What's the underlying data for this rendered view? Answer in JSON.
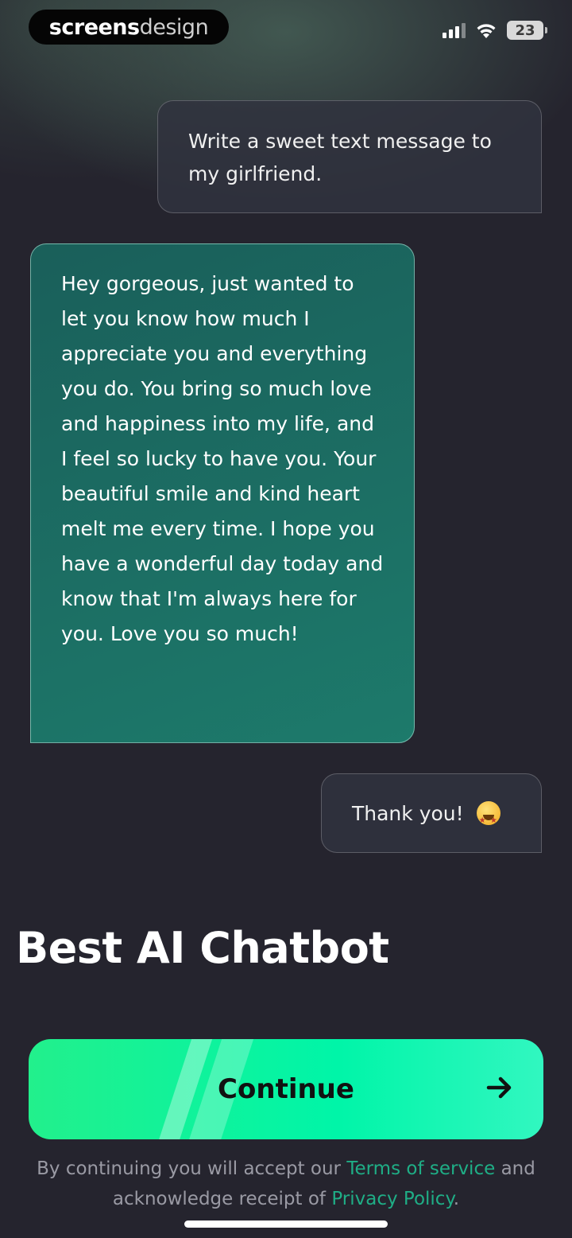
{
  "status_bar": {
    "brand_part1": "screens",
    "brand_part2": "design",
    "battery": "23"
  },
  "chat": {
    "user_message_1": "Write a sweet text message to my girlfriend.",
    "ai_reply": "Hey gorgeous, just wanted to let you know how much I appreciate you and everything you do. You bring so much love and happiness into my life, and I feel so lucky to have you. Your beautiful smile and kind heart melt me every time. I hope you have a wonderful day today and know that I'm always here for you. Love you so much!",
    "user_message_2": "Thank you!",
    "user_message_2_emoji": "star-struck-emoji-icon"
  },
  "headline": "Best AI Chatbot",
  "cta": {
    "label": "Continue",
    "icon": "arrow-right-icon"
  },
  "legal": {
    "prefix": "By continuing you will accept our",
    "terms_link": "Terms of service",
    "middle": "and acknowledge receipt of",
    "privacy_link": "Privacy Policy",
    "suffix": "."
  },
  "colors": {
    "accent": "#00f5a8",
    "ai_bubble": "#1d7a6b",
    "link": "#1fae86",
    "background": "#25242e"
  }
}
